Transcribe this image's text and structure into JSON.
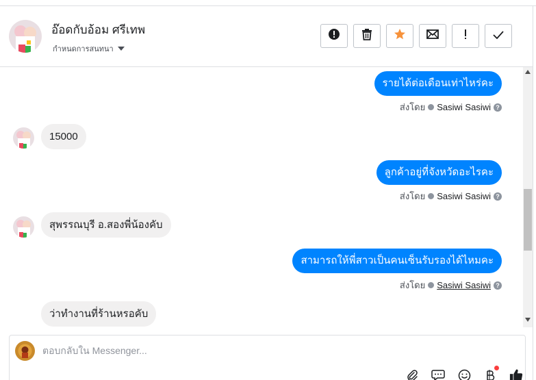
{
  "header": {
    "contact_name": "อ๊อดกับอ้อม ศรีเทพ",
    "status_label": "กำหนดการสนทนา",
    "actions": [
      {
        "name": "report-button",
        "icon": "alert-circle-icon"
      },
      {
        "name": "delete-button",
        "icon": "trash-icon"
      },
      {
        "name": "star-button",
        "icon": "star-icon"
      },
      {
        "name": "mark-unread-button",
        "icon": "envelope-icon"
      },
      {
        "name": "spam-button",
        "icon": "exclamation-icon"
      },
      {
        "name": "done-button",
        "icon": "check-icon"
      }
    ]
  },
  "messages": [
    {
      "direction": "out",
      "text": "รายได้ต่อเดือนเท่าไหร่คะ",
      "sent_by_label": "ส่งโดย",
      "sender": "Sasiwi Sasiwi"
    },
    {
      "direction": "in",
      "text": "15000"
    },
    {
      "direction": "out",
      "text": "ลูกค้าอยู่ที่จังหวัดอะไรคะ",
      "sent_by_label": "ส่งโดย",
      "sender": "Sasiwi Sasiwi"
    },
    {
      "direction": "in",
      "text": "สุพรรณบุรี อ.สองพี่น้องคับ"
    },
    {
      "direction": "out",
      "text": "สามารถให้พี่สาวเป็นคนเซ็นรับรองได้ไหมคะ",
      "sent_by_label": "ส่งโดย",
      "sender": "Sasiwi Sasiwi"
    },
    {
      "direction": "in",
      "text": "ว่าทำงานที่ร้านหรอคับ"
    }
  ],
  "composer": {
    "placeholder": "ตอบกลับใน Messenger...",
    "tools": [
      "paperclip-icon",
      "saved-reply-icon",
      "emoji-icon",
      "bot-icon",
      "thumbs-up-icon"
    ]
  },
  "colors": {
    "outgoing_bubble": "#0084ff",
    "incoming_bubble": "#f1f0f0",
    "star": "#f7923b",
    "notification": "#fa3e3e"
  }
}
